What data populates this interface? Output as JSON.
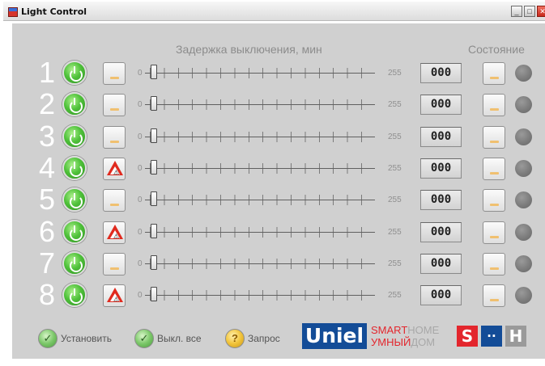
{
  "window": {
    "title": "Light Control"
  },
  "headers": {
    "delay": "Задержка выключения, мин",
    "state": "Состояние"
  },
  "slider": {
    "min_label": "0",
    "max_label": "255"
  },
  "rows": [
    {
      "num": "1",
      "mode": "bar",
      "value": "000",
      "slider_value": 0
    },
    {
      "num": "2",
      "mode": "bar",
      "value": "000",
      "slider_value": 0
    },
    {
      "num": "3",
      "mode": "bar",
      "value": "000",
      "slider_value": 0
    },
    {
      "num": "4",
      "mode": "warning",
      "value": "000",
      "slider_value": 0
    },
    {
      "num": "5",
      "mode": "bar",
      "value": "000",
      "slider_value": 0
    },
    {
      "num": "6",
      "mode": "warning",
      "value": "000",
      "slider_value": 0
    },
    {
      "num": "7",
      "mode": "bar",
      "value": "000",
      "slider_value": 0
    },
    {
      "num": "8",
      "mode": "warning",
      "value": "000",
      "slider_value": 0
    }
  ],
  "footer": {
    "set_label": "Установить",
    "all_off_label": "Выкл. все",
    "request_label": "Запрос"
  },
  "brand": {
    "uniel": "Uniel",
    "smart_red": "SMART",
    "smart_gray": "HOME",
    "umny_red": "УМНЫЙ",
    "umny_gray": "ДОМ",
    "logo_s": "S",
    "logo_dots": "··",
    "logo_h": "H"
  },
  "colors": {
    "panel": "#d0d0d0",
    "power_green": "#4fc23a",
    "warning_red": "#e02a1e",
    "brand_blue": "#134c97",
    "brand_red": "#e3262d",
    "status_off": "#7c7c7c"
  },
  "icons": {
    "power": "power-icon",
    "mode_bar": "mode-bar-icon",
    "mode_warning": "pedestrian-warning-icon",
    "status": "status-indicator-icon",
    "check": "check-icon",
    "help": "question-icon"
  }
}
